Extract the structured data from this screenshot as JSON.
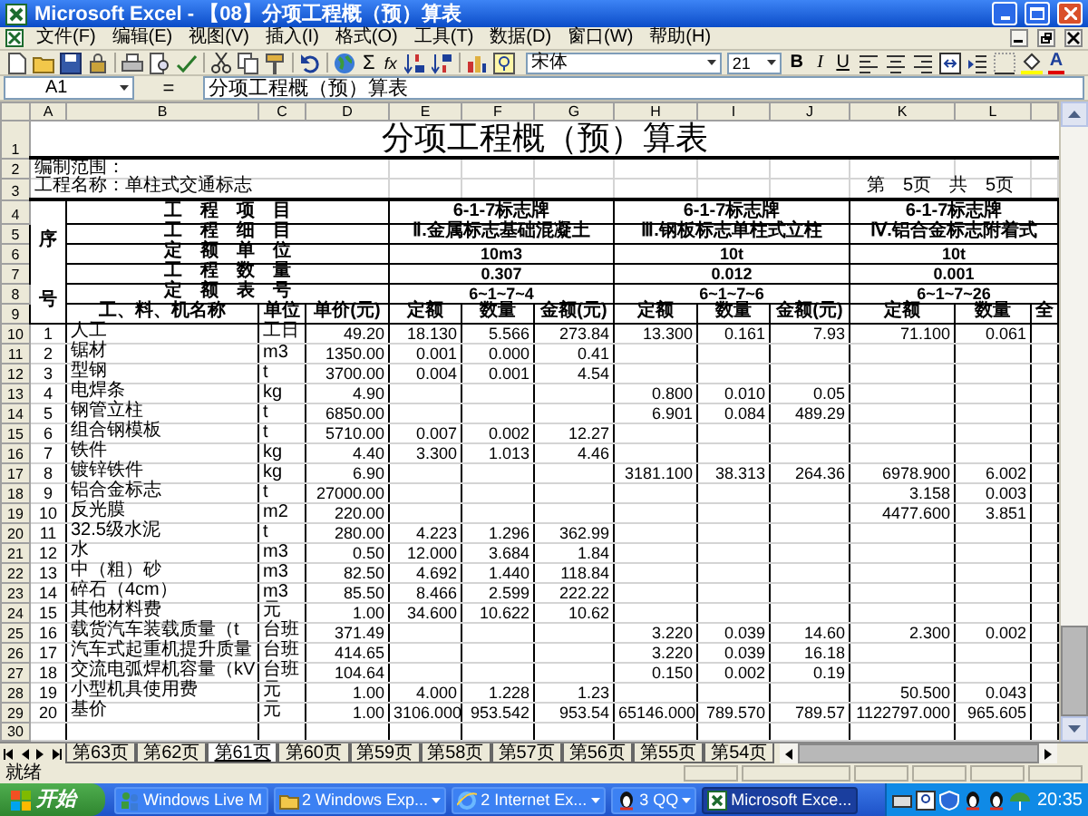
{
  "window": {
    "title": "Microsoft Excel - 【08】分项工程概（预）算表"
  },
  "menu": [
    "文件(F)",
    "编辑(E)",
    "视图(V)",
    "插入(I)",
    "格式(O)",
    "工具(T)",
    "数据(D)",
    "窗口(W)",
    "帮助(H)"
  ],
  "toolbar": {
    "sum": "Σ",
    "function": "fx",
    "font": "宋体",
    "size": "21",
    "bold": "B",
    "italic": "I",
    "underline": "U",
    "font_color": "A"
  },
  "formula_bar": {
    "cell": "A1",
    "equals": "=",
    "content": "分项工程概（预）算表"
  },
  "sheet": {
    "columns": [
      "A",
      "B",
      "C",
      "D",
      "E",
      "F",
      "G",
      "H",
      "I",
      "J",
      "K",
      "L"
    ],
    "row_numbers": [
      "1",
      "2",
      "3",
      "4",
      "5",
      "6",
      "7",
      "8",
      "9",
      "10",
      "11",
      "12",
      "13",
      "14",
      "15",
      "16",
      "17",
      "18",
      "19",
      "20",
      "21",
      "22",
      "23",
      "24",
      "25",
      "26",
      "27",
      "28",
      "29",
      "30"
    ],
    "title": "分项工程概（预）算表",
    "scope": "编制范围：",
    "project": "工程名称：单柱式交通标志",
    "page": "第　5页　共　5页",
    "seq_top": "序",
    "seq_bottom": "号",
    "labels": [
      "工　程　项　目",
      "工　程　细　目",
      "定　额　单　位",
      "工　程　数　量",
      "定　额　表　号"
    ],
    "groups": [
      [
        "6-1-7标志牌",
        "Ⅱ.金属标志基础混凝土",
        "10m3",
        "0.307",
        "6~1~7~4"
      ],
      [
        "6-1-7标志牌",
        "Ⅲ.钢板标志单柱式立柱",
        "10t",
        "0.012",
        "6~1~7~6"
      ],
      [
        "6-1-7标志牌",
        "Ⅳ.铝合金标志附着式",
        "10t",
        "0.001",
        "6~1~7~26"
      ]
    ],
    "headers": [
      "工、料、机名称",
      "单位",
      "单价(元)",
      "定额",
      "数量",
      "金额(元)",
      "定额",
      "数量",
      "金额(元)",
      "定额",
      "数量",
      "全"
    ],
    "rows": [
      {
        "A": "1",
        "B": "人工",
        "C": "工日",
        "D": "49.20",
        "E": "18.130",
        "F": "5.566",
        "G": "273.84",
        "H": "13.300",
        "I": "0.161",
        "J": "7.93",
        "K": "71.100",
        "L": "0.061"
      },
      {
        "A": "2",
        "B": "锯材",
        "C": "m3",
        "D": "1350.00",
        "E": "0.001",
        "F": "0.000",
        "G": "0.41"
      },
      {
        "A": "3",
        "B": "型钢",
        "C": "t",
        "D": "3700.00",
        "E": "0.004",
        "F": "0.001",
        "G": "4.54"
      },
      {
        "A": "4",
        "B": "电焊条",
        "C": "kg",
        "D": "4.90",
        "H": "0.800",
        "I": "0.010",
        "J": "0.05"
      },
      {
        "A": "5",
        "B": "钢管立柱",
        "C": "t",
        "D": "6850.00",
        "H": "6.901",
        "I": "0.084",
        "J": "489.29"
      },
      {
        "A": "6",
        "B": "组合钢模板",
        "C": "t",
        "D": "5710.00",
        "E": "0.007",
        "F": "0.002",
        "G": "12.27"
      },
      {
        "A": "7",
        "B": "铁件",
        "C": "kg",
        "D": "4.40",
        "E": "3.300",
        "F": "1.013",
        "G": "4.46"
      },
      {
        "A": "8",
        "B": "镀锌铁件",
        "C": "kg",
        "D": "6.90",
        "H": "3181.100",
        "I": "38.313",
        "J": "264.36",
        "K": "6978.900",
        "L": "6.002"
      },
      {
        "A": "9",
        "B": "铝合金标志",
        "C": "t",
        "D": "27000.00",
        "K": "3.158",
        "L": "0.003"
      },
      {
        "A": "10",
        "B": "反光膜",
        "C": "m2",
        "D": "220.00",
        "K": "4477.600",
        "L": "3.851"
      },
      {
        "A": "11",
        "B": "32.5级水泥",
        "C": "t",
        "D": "280.00",
        "E": "4.223",
        "F": "1.296",
        "G": "362.99"
      },
      {
        "A": "12",
        "B": "水",
        "C": "m3",
        "D": "0.50",
        "E": "12.000",
        "F": "3.684",
        "G": "1.84"
      },
      {
        "A": "13",
        "B": "中（粗）砂",
        "C": "m3",
        "D": "82.50",
        "E": "4.692",
        "F": "1.440",
        "G": "118.84"
      },
      {
        "A": "14",
        "B": "碎石（4cm）",
        "C": "m3",
        "D": "85.50",
        "E": "8.466",
        "F": "2.599",
        "G": "222.22"
      },
      {
        "A": "15",
        "B": "其他材料费",
        "C": "元",
        "D": "1.00",
        "E": "34.600",
        "F": "10.622",
        "G": "10.62"
      },
      {
        "A": "16",
        "B": "载货汽车装载质量（t",
        "C": "台班",
        "D": "371.49",
        "H": "3.220",
        "I": "0.039",
        "J": "14.60",
        "K": "2.300",
        "L": "0.002"
      },
      {
        "A": "17",
        "B": "汽车式起重机提升质量",
        "C": "台班",
        "D": "414.65",
        "H": "3.220",
        "I": "0.039",
        "J": "16.18"
      },
      {
        "A": "18",
        "B": "交流电弧焊机容量（kV",
        "C": "台班",
        "D": "104.64",
        "H": "0.150",
        "I": "0.002",
        "J": "0.19"
      },
      {
        "A": "19",
        "B": "小型机具使用费",
        "C": "元",
        "D": "1.00",
        "E": "4.000",
        "F": "1.228",
        "G": "1.23",
        "K": "50.500",
        "L": "0.043"
      },
      {
        "A": "20",
        "B": "基价",
        "C": "元",
        "D": "1.00",
        "E": "3106.000",
        "F": "953.542",
        "G": "953.54",
        "H": "65146.000",
        "I": "789.570",
        "J": "789.57",
        "K": "1122797.000",
        "L": "965.605"
      }
    ],
    "tabs": [
      {
        "label": "第63页",
        "selected": false
      },
      {
        "label": "第62页",
        "selected": false
      },
      {
        "label": "第61页",
        "selected": true
      },
      {
        "label": "第60页",
        "selected": false
      },
      {
        "label": "第59页",
        "selected": false
      },
      {
        "label": "第58页",
        "selected": false
      },
      {
        "label": "第57页",
        "selected": false
      },
      {
        "label": "第56页",
        "selected": false
      },
      {
        "label": "第55页",
        "selected": false
      },
      {
        "label": "第54页",
        "selected": false
      }
    ]
  },
  "status_bar": {
    "text": "就绪"
  },
  "taskbar": {
    "start": "开始",
    "tasks": [
      {
        "kind": "messenger",
        "label": "Windows Live M",
        "grouped": false,
        "selected": false
      },
      {
        "kind": "folder",
        "label": "2 Windows Exp...",
        "grouped": true,
        "selected": false
      },
      {
        "kind": "browser",
        "label": "2 Internet Ex...",
        "grouped": true,
        "selected": false
      },
      {
        "kind": "chat",
        "label": "3 QQ",
        "grouped": true,
        "selected": false
      },
      {
        "kind": "spreadsheet",
        "label": "Microsoft Exce...",
        "grouped": false,
        "selected": true
      }
    ],
    "clock": "20:35"
  }
}
